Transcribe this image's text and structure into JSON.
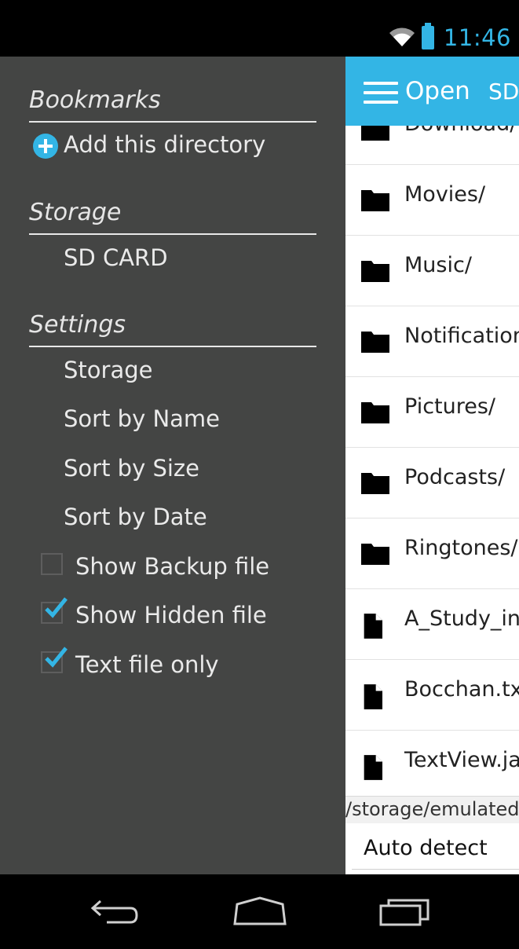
{
  "status_bar": {
    "time": "11:46",
    "wifi_icon": "wifi-icon",
    "battery_icon": "battery-icon",
    "accent": "#33b5e5"
  },
  "drawer": {
    "bookmarks_header": "Bookmarks",
    "add_directory": "Add this directory",
    "storage_header": "Storage",
    "storage_item": "SD CARD",
    "settings_header": "Settings",
    "settings_items": [
      "Storage",
      "Sort by Name",
      "Sort by Size",
      "Sort by Date"
    ],
    "checkboxes": [
      {
        "label": "Show Backup file",
        "checked": false
      },
      {
        "label": "Show Hidden file",
        "checked": true
      },
      {
        "label": "Text file only",
        "checked": true
      }
    ]
  },
  "content": {
    "action_bar": {
      "open_label": "Open",
      "sd_label": "SD"
    },
    "files": [
      {
        "name": "Download/",
        "type": "folder"
      },
      {
        "name": "Movies/",
        "type": "folder"
      },
      {
        "name": "Music/",
        "type": "folder"
      },
      {
        "name": "Notifications/",
        "type": "folder"
      },
      {
        "name": "Pictures/",
        "type": "folder"
      },
      {
        "name": "Podcasts/",
        "type": "folder"
      },
      {
        "name": "Ringtones/",
        "type": "folder"
      },
      {
        "name": "A_Study_in_",
        "type": "file"
      },
      {
        "name": "Bocchan.txt",
        "type": "file"
      },
      {
        "name": "TextView.ja",
        "type": "file"
      }
    ],
    "path": "/storage/emulated/",
    "encoding": "Auto detect"
  },
  "nav_bar": {
    "back_icon": "back-icon",
    "home_icon": "home-icon",
    "recents_icon": "recents-icon"
  }
}
